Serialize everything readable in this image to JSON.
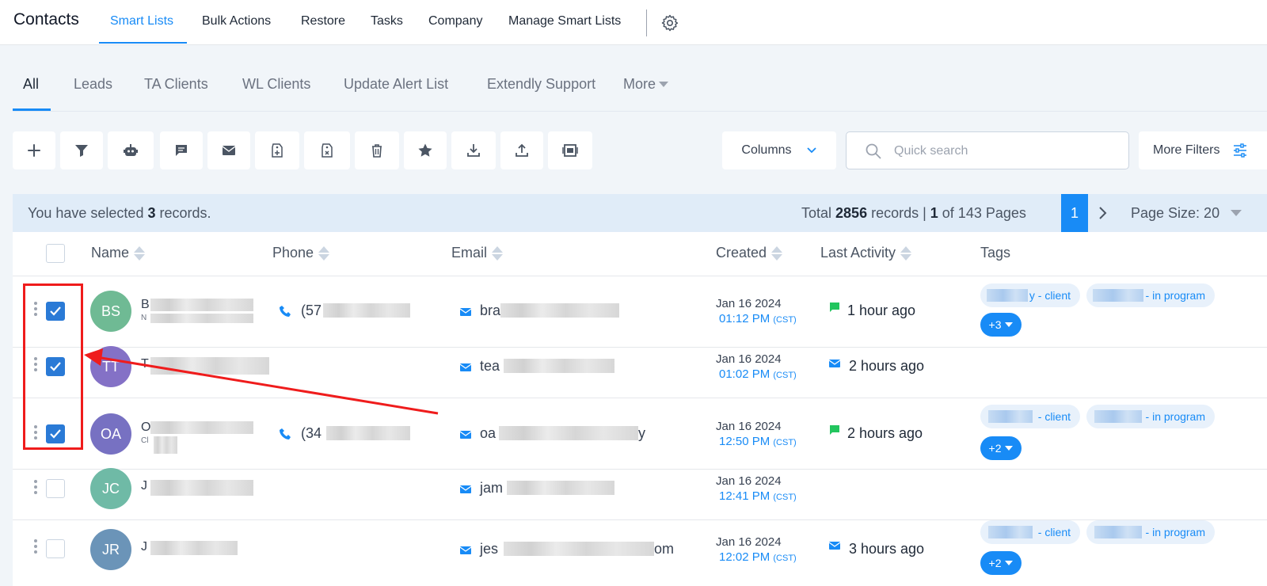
{
  "app": {
    "title": "Contacts"
  },
  "topnav": {
    "items": [
      "Smart Lists",
      "Bulk Actions",
      "Restore",
      "Tasks",
      "Company",
      "Manage Smart Lists"
    ]
  },
  "subtabs": [
    "All",
    "Leads",
    "TA Clients",
    "WL Clients",
    "Update Alert List",
    "Extendly Support",
    "More"
  ],
  "toolbar": {
    "icons": [
      "plus-icon",
      "filter-icon",
      "robot-icon",
      "message-icon",
      "mail-icon",
      "add-tag-icon",
      "remove-tag-icon",
      "trash-icon",
      "star-icon",
      "download-icon",
      "upload-icon",
      "merge-icon"
    ],
    "columns_label": "Columns",
    "search_placeholder": "Quick search",
    "more_filters_label": "More Filters"
  },
  "selection": {
    "prefix": "You have selected ",
    "count": "3",
    "suffix": " records.",
    "total_prefix": "Total ",
    "total": "2856",
    "total_mid": " records | ",
    "page": "1",
    "page_suffix": " of 143 Pages",
    "current_page": "1",
    "page_size": "Page Size: 20"
  },
  "table": {
    "headers": {
      "name": "Name",
      "phone": "Phone",
      "email": "Email",
      "created": "Created",
      "last_activity": "Last Activity",
      "tags": "Tags"
    },
    "rows": [
      {
        "initials": "BS",
        "avatar_color": "#6fba94",
        "name": "B",
        "sub": "N",
        "phone": "(57",
        "email": "bra",
        "date": "Jan 16 2024",
        "time": "01:12 PM",
        "tz": "(CST)",
        "activity_icon": "chat-icon",
        "activity": "1 hour ago",
        "tag1": "y - client",
        "tag2": "y - in program",
        "more": "+3",
        "checked": true
      },
      {
        "initials": "TT",
        "avatar_color": "#8471c6",
        "name": "T",
        "sub": "",
        "phone": "",
        "email": "tea",
        "date": "Jan 16 2024",
        "time": "01:02 PM",
        "tz": "(CST)",
        "activity_icon": "mail-icon",
        "activity": "2 hours ago",
        "tag1": "",
        "tag2": "",
        "more": "",
        "checked": true
      },
      {
        "initials": "OA",
        "avatar_color": "#7771c2",
        "name": "O",
        "sub": "Cl",
        "phone": "(34",
        "email": "oa",
        "email_end": "y",
        "date": "Jan 16 2024",
        "time": "12:50 PM",
        "tz": "(CST)",
        "activity_icon": "chat-icon",
        "activity": "2 hours ago",
        "tag1": "- client",
        "tag2": "- in program",
        "more": "+2",
        "checked": true
      },
      {
        "initials": "JC",
        "avatar_color": "#6fbaa6",
        "name": "J",
        "sub": "",
        "phone": "",
        "email": "jam",
        "date": "Jan 16 2024",
        "time": "12:41 PM",
        "tz": "(CST)",
        "activity_icon": "",
        "activity": "",
        "tag1": "",
        "tag2": "",
        "more": "",
        "checked": false
      },
      {
        "initials": "JR",
        "avatar_color": "#6b94b8",
        "name": "J",
        "sub": "",
        "phone": "",
        "email": "jes",
        "email_end": "om",
        "date": "Jan 16 2024",
        "time": "12:02 PM",
        "tz": "(CST)",
        "activity_icon": "mail-icon",
        "activity": "3 hours ago",
        "tag1": "- client",
        "tag2": "- in program",
        "more": "+2",
        "checked": false
      }
    ]
  },
  "colors": {
    "accent": "#188bf6",
    "annotation": "#ef1c1c",
    "checkbox": "#2a7ad6"
  }
}
